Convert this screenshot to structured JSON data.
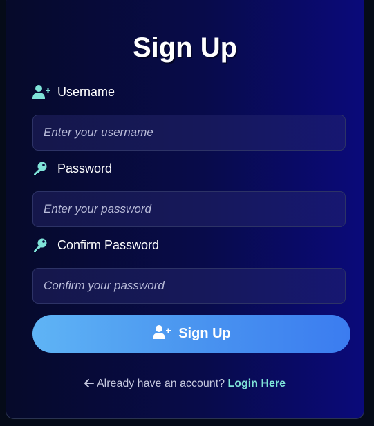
{
  "page": {
    "title": "Sign Up"
  },
  "fields": {
    "username": {
      "label": "Username",
      "icon": "user-plus-icon",
      "placeholder": "Enter your username",
      "value": ""
    },
    "password": {
      "label": "Password",
      "icon": "key-icon",
      "placeholder": "Enter your password",
      "value": ""
    },
    "confirm_password": {
      "label": "Confirm Password",
      "icon": "key-icon",
      "placeholder": "Confirm your password",
      "value": ""
    }
  },
  "signup_button": {
    "label": "Sign Up",
    "icon": "user-plus-icon"
  },
  "footer": {
    "arrow_icon": "arrow-left-icon",
    "prompt": "Already have an account?",
    "link_label": "Login Here"
  },
  "colors": {
    "accent": "#7fe3d8",
    "button_start": "#5fb4f5",
    "button_end": "#3b7cf0",
    "background_start": "#060a2a",
    "background_end": "#0a0a7a"
  }
}
